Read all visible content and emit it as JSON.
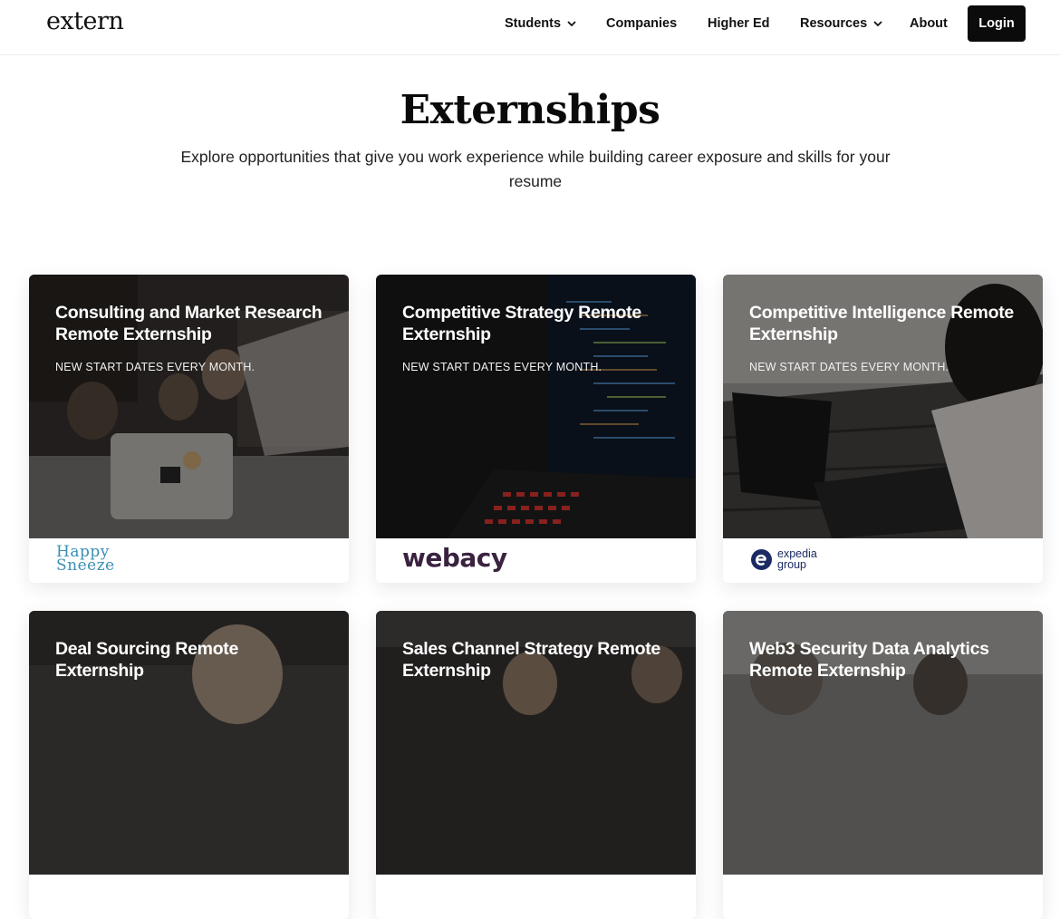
{
  "brand": {
    "logo": "extern"
  },
  "nav": {
    "students": "Students",
    "companies": "Companies",
    "higher_ed": "Higher Ed",
    "resources": "Resources",
    "about": "About",
    "login": "Login"
  },
  "hero": {
    "title": "Externships",
    "subtitle": "Explore opportunities that give you work experience while building career exposure and skills for your resume"
  },
  "cards": [
    {
      "title": "Consulting and Market Research Remote Externship",
      "start": "NEW START DATES EVERY MONTH.",
      "company_logo": "Happy Sneeze",
      "company_logo_l1": "Happy",
      "company_logo_l2": "Sneeze"
    },
    {
      "title": "Competitive Strategy Remote Externship",
      "start": "NEW START DATES EVERY MONTH.",
      "company_logo": "webacy"
    },
    {
      "title": "Competitive Intelligence Remote Externship",
      "start": "NEW START DATES EVERY MONTH.",
      "company_logo": "expedia group",
      "company_logo_l1": "expedia",
      "company_logo_l2": "group"
    },
    {
      "title": "Deal Sourcing Remote Externship"
    },
    {
      "title": "Sales Channel Strategy Remote Externship"
    },
    {
      "title": "Web3 Security Data Analytics Remote Externship"
    }
  ],
  "colors": {
    "login_bg": "#0b0b0b",
    "happy_sneeze": "#3a8fb3",
    "webacy": "#3a2340",
    "expedia": "#1b2a63"
  }
}
